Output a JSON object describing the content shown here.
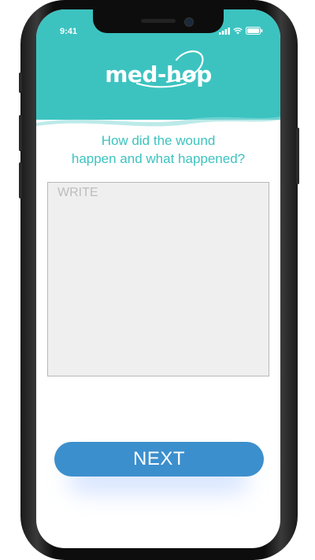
{
  "status_bar": {
    "time": "9:41",
    "icons": [
      "signal-icon",
      "wifi-icon",
      "battery-icon"
    ]
  },
  "brand": {
    "logo_text": "med-hop",
    "primary_color": "#3cc3c0",
    "button_color": "#3c8fcd"
  },
  "question": {
    "line1": "How did the wound",
    "line2": "happen and what happened?"
  },
  "answer_field": {
    "placeholder": "WRITE",
    "value": ""
  },
  "next_button": {
    "label": "NEXT"
  }
}
